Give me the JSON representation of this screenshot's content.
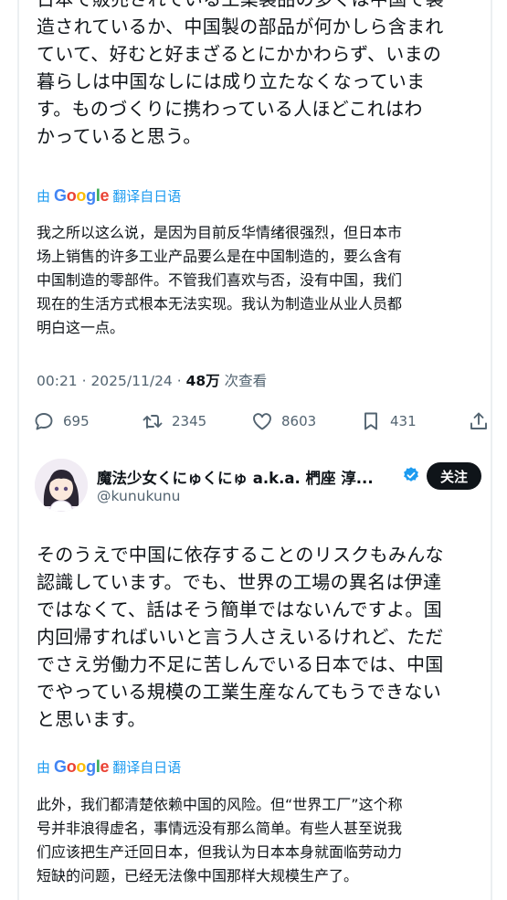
{
  "tweet1": {
    "original_lines": [
      "日本で販売されている工業製品の多くは中国で製",
      "造されているか、中国製の部品が何かしら含まれ",
      "ていて、好むと好まざるとにかかわらず、いまの",
      "暮らしは中国なしには成り立たなくなっていま",
      "す。ものづくりに携わっている人ほどこれはわ",
      "かっていると思う。"
    ],
    "translate_prefix": "由",
    "translate_brand": "Google",
    "translate_suffix": "翻译自日语",
    "translated_lines": [
      "我之所以这么说，是因为目前反华情绪很强烈，但日本市",
      "场上销售的许多工业产品要么是在中国制造的，要么含有",
      "中国制造的零部件。不管我们喜欢与否，没有中国，我们",
      "现在的生活方式根本无法实现。我认为制造业从业人员都",
      "明白这一点。"
    ],
    "timestamp": "00:21 · 2025/11/24 · ",
    "views_count": "48万",
    "views_label": " 次查看",
    "stats": {
      "replies": "695",
      "retweets": "2345",
      "likes": "8603",
      "bookmarks": "431"
    }
  },
  "tweet2": {
    "author_name": "魔法少女くにゅくにゅ a.k.a. 椚座 淳...",
    "author_handle": "@kunukunu",
    "follow_label": "关注",
    "original_lines": [
      "そのうえで中国に依存することのリスクもみんな",
      "認識しています。でも、世界の工場の異名は伊達",
      "ではなくて、話はそう簡単ではないんですよ。国",
      "内回帰すればいいと言う人さえいるけれど、ただ",
      "でさえ労働力不足に苦しんでいる日本では、中国",
      "でやっている規模の工業生産なんてもうできない",
      "と思います。"
    ],
    "translate_prefix": "由",
    "translate_brand": "Google",
    "translate_suffix": "翻译自日语",
    "translated_lines": [
      "此外，我们都清楚依赖中国的风险。但“世界工厂”这个称",
      "号并非浪得虚名，事情远没有那么简单。有些人甚至说我",
      "们应该把生产迁回日本，但我认为日本本身就面临劳动力",
      "短缺的问题，已经无法像中国那样大规模生产了。"
    ]
  },
  "colors": {
    "accent": "#1d9bf0",
    "text": "#0f1419",
    "muted": "#536471"
  },
  "icons": [
    "reply-icon",
    "retweet-icon",
    "like-icon",
    "bookmark-icon",
    "share-icon",
    "verified-badge-icon"
  ]
}
